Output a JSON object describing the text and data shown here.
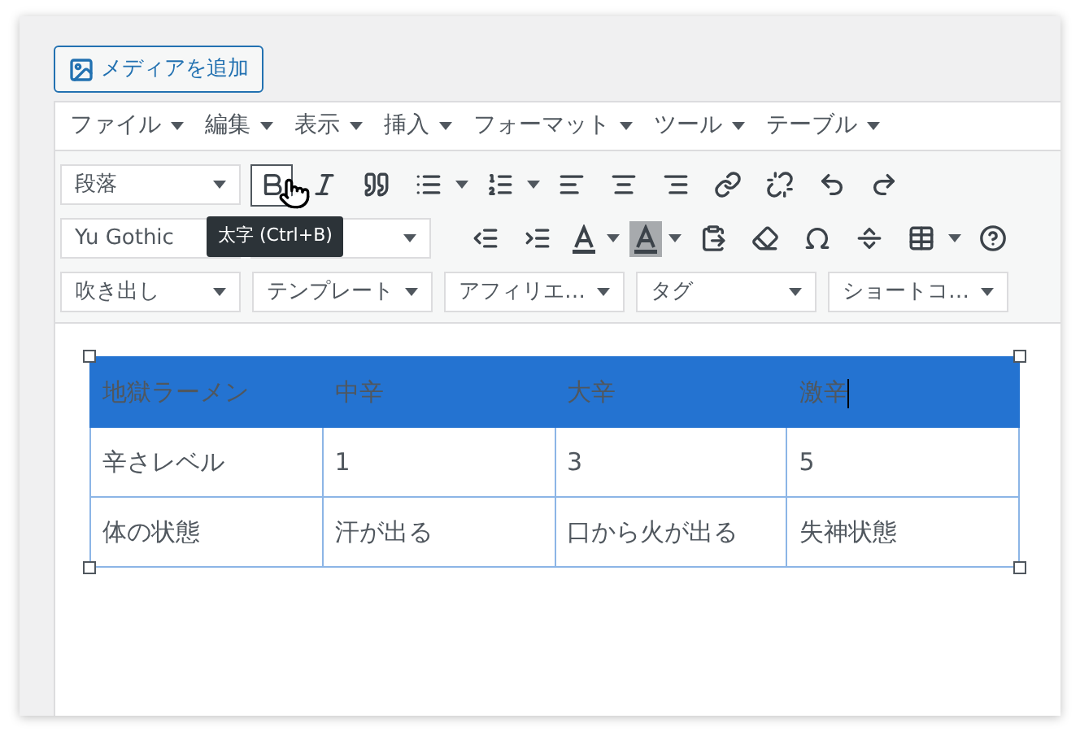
{
  "media_button": {
    "label": "メディアを追加"
  },
  "menu": [
    "ファイル",
    "編集",
    "表示",
    "挿入",
    "フォーマット",
    "ツール",
    "テーブル"
  ],
  "toolbar": {
    "format_select": "段落",
    "bold_hovered": true,
    "tooltip": "太字 (Ctrl+B)",
    "font_select": "Yu Gothic",
    "selects": [
      "吹き出し",
      "テンプレート",
      "アフィリエ…",
      "タグ",
      "ショートコ…"
    ]
  },
  "table": {
    "rows": [
      {
        "highlighted": true,
        "cells": [
          {
            "text": "地獄ラーメン",
            "cursor": false
          },
          {
            "text": "中辛",
            "cursor": false
          },
          {
            "text": "大辛",
            "cursor": false
          },
          {
            "text": "激辛",
            "cursor": true
          }
        ]
      },
      {
        "highlighted": false,
        "cells": [
          {
            "text": "辛さレベル",
            "cursor": false
          },
          {
            "text": "1",
            "cursor": false
          },
          {
            "text": "3",
            "cursor": false
          },
          {
            "text": "5",
            "cursor": false
          }
        ]
      },
      {
        "highlighted": false,
        "cells": [
          {
            "text": "体の状態",
            "cursor": false
          },
          {
            "text": "汗が出る",
            "cursor": false
          },
          {
            "text": "口から火が出る",
            "cursor": false
          },
          {
            "text": "失神状態",
            "cursor": false
          }
        ]
      }
    ]
  }
}
